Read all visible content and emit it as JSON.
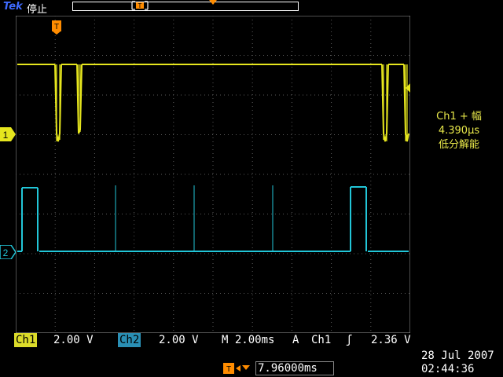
{
  "header": {
    "brand": "Tek",
    "run_status": "停止",
    "trigger_marker": "T"
  },
  "screen": {
    "trigger_marker": "T",
    "ch1_marker": "1",
    "ch2_marker": "2"
  },
  "measurement": {
    "line1": "Ch1 + 幅",
    "line2": "4.390µs",
    "line3": "低分解能"
  },
  "statusbar": {
    "ch1_label": "Ch1",
    "ch1_scale": "2.00 V",
    "ch2_label": "Ch2",
    "ch2_scale": "2.00 V",
    "timebase": "M 2.00ms",
    "trigger_mode": "A",
    "trigger_source": "Ch1",
    "trigger_slope": "ʃ",
    "trigger_level": "2.36 V"
  },
  "trigger_position": {
    "value": "7.96000ms"
  },
  "timestamp": {
    "date": "28 Jul  2007",
    "time": "02:44:36"
  },
  "colors": {
    "ch1": "#e6e61e",
    "ch2": "#22c6d8",
    "accent": "#ff8c00",
    "grid": "#5a5a5a"
  }
}
